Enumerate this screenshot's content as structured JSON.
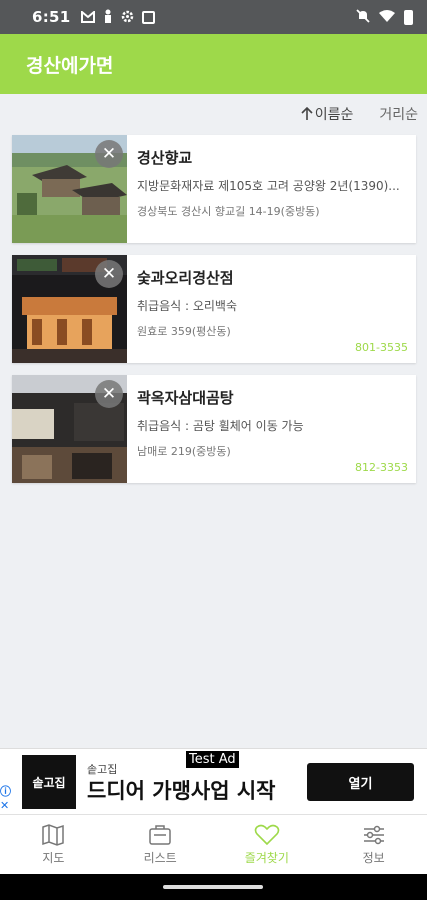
{
  "status_bar": {
    "time": "6:51"
  },
  "app_bar": {
    "title": "경산에가면"
  },
  "sort": {
    "name_label": "이름순",
    "distance_label": "거리순"
  },
  "places": [
    {
      "title": "경산향교",
      "description": "지방문화재자료 제105호 고려 공양왕 2년(1390)...",
      "address": "경상북도 경산시 향교길 14-19(중방동)",
      "phone": ""
    },
    {
      "title": "숯과오리경산점",
      "description": "취급음식 : 오리백숙",
      "address": "원효로 359(평산동)",
      "phone": "801-3535"
    },
    {
      "title": "곽옥자삼대곰탕",
      "description": "취급음식 : 곰탕 휠체어 이동 가능",
      "address": "남매로 219(중방동)",
      "phone": "812-3353"
    }
  ],
  "ad": {
    "label": "Test Ad",
    "brand": "솥고집",
    "logo_text": "솥고집",
    "headline": "드디어 가맹사업 시작",
    "cta": "열기"
  },
  "bottom_nav": {
    "items": [
      {
        "label": "지도",
        "icon": "map-icon"
      },
      {
        "label": "리스트",
        "icon": "list-icon"
      },
      {
        "label": "즐겨찾기",
        "icon": "heart-icon"
      },
      {
        "label": "정보",
        "icon": "settings-sliders-icon"
      }
    ],
    "active": "즐겨찾기"
  },
  "colors": {
    "accent": "#9ed94a",
    "status_bar": "#555759"
  }
}
